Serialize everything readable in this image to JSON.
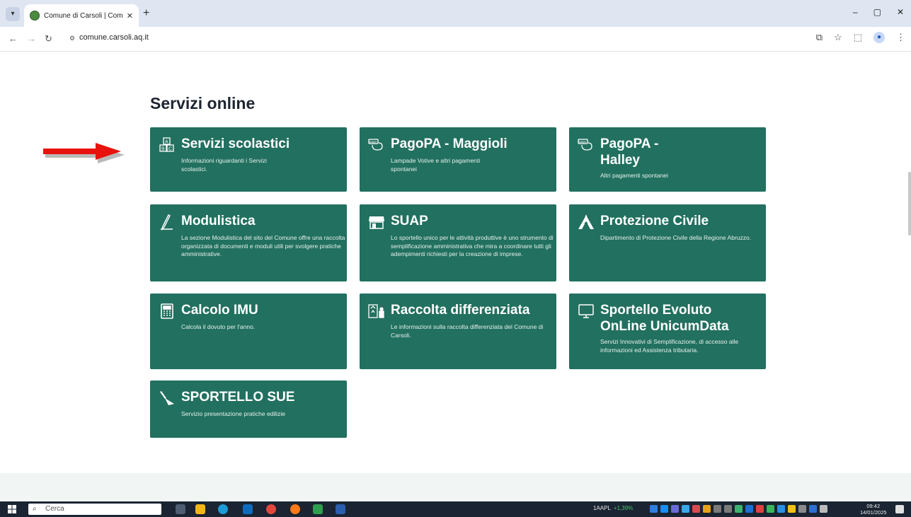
{
  "browser": {
    "tab_title": "Comune di Carsoli | Comune di",
    "tab_close": "✕",
    "new_tab": "+",
    "url": "comune.carsoli.aq.it",
    "window_controls": [
      "–",
      "▢",
      "✕"
    ]
  },
  "page": {
    "section_title": "Servizi online",
    "cards": [
      {
        "title": "Servizi scolastici",
        "desc": "Informazioni riguardanti i Servizi scolastici.",
        "icon": "abc-blocks-icon"
      },
      {
        "title": "PagoPA - Maggioli",
        "desc": "Lampade Votive e altri pagamenti spontanei",
        "icon": "pagopa-icon"
      },
      {
        "title": "PagoPA - Halley",
        "desc": "Altri pagamenti spontanei",
        "icon": "pagopa-icon"
      },
      {
        "title": "Modulistica",
        "desc": "La sezione Modulistica del sito del Comune offre una raccolta organizzata di documenti e moduli utili per svolgere pratiche amministrative.",
        "icon": "pen-icon"
      },
      {
        "title": "SUAP",
        "desc": "Lo sportello unico per le attività produttive è uno strumento di semplificazione amministrativa che mira a coordinare tutti gli adempimenti richiesti per la creazione di imprese.",
        "icon": "shop-icon"
      },
      {
        "title": "Protezione Civile",
        "desc": "Dipartimento di Protezione Civile della Regione Abruzzo.",
        "icon": "protezione-civile-icon"
      },
      {
        "title": "Calcolo IMU",
        "desc": "Calcola il dovuto per l'anno.",
        "icon": "calculator-icon"
      },
      {
        "title": "Raccolta differenziata",
        "desc": "Le informazioni sulla raccolta differenziata del Comune di Carsoli.",
        "icon": "recycling-bins-icon"
      },
      {
        "title": "Sportello Evoluto OnLine UnicumData",
        "desc": "Servizi Innovativi di Semplificazione, di accesso alle informazioni ed Assistenza tributaria.",
        "icon": "monitor-icon"
      },
      {
        "title": "SPORTELLO SUE",
        "desc": "Servizio presentazione pratiche edilizie",
        "icon": "trowel-icon"
      }
    ],
    "card_color": "#22705f"
  },
  "taskbar": {
    "search_placeholder": "Cerca",
    "ticker_symbol": "1AAPL",
    "ticker_change": "+1,39%",
    "time": "09:42",
    "date": "14/01/2025"
  }
}
